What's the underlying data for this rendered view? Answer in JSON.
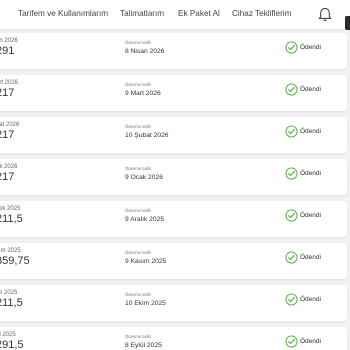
{
  "nav": {
    "items": [
      "Tarifem ve Kullanımlarım",
      "Talimatlarım",
      "Ek Paket Al",
      "Cihaz Tekliflerim"
    ]
  },
  "invoices": {
    "paid_date_label": "Ödenme tarihi",
    "rows": [
      {
        "period": "an 2026",
        "amount": "291",
        "paid_date": "8 Nisan 2026",
        "status": "Ödendi"
      },
      {
        "period": "art 2026",
        "amount": "217",
        "paid_date": "9 Mart 2026",
        "status": "Ödendi"
      },
      {
        "period": "bat 2026",
        "amount": "217",
        "paid_date": "10 Şubat 2026",
        "status": "Ödendi"
      },
      {
        "period": "ak 2026",
        "amount": "217",
        "paid_date": "9 Ocak 2026",
        "status": "Ödendi"
      },
      {
        "period": "alık 2025",
        "amount": "211,5",
        "paid_date": "9 Aralık 2025",
        "status": "Ödendi"
      },
      {
        "period": "sım 2025",
        "amount": "359,75",
        "paid_date": "9 Kasım 2025",
        "status": "Ödendi"
      },
      {
        "period": "im 2025",
        "amount": "211,5",
        "paid_date": "10 Ekim 2025",
        "status": "Ödendi"
      },
      {
        "period": "ül 2025",
        "amount": "291,5",
        "paid_date": "8 Eylül 2025",
        "status": "Ödendi"
      }
    ]
  },
  "colors": {
    "success": "#4cae3a"
  },
  "icons": {
    "notification": "bell-icon",
    "paid": "check-circle-icon"
  }
}
